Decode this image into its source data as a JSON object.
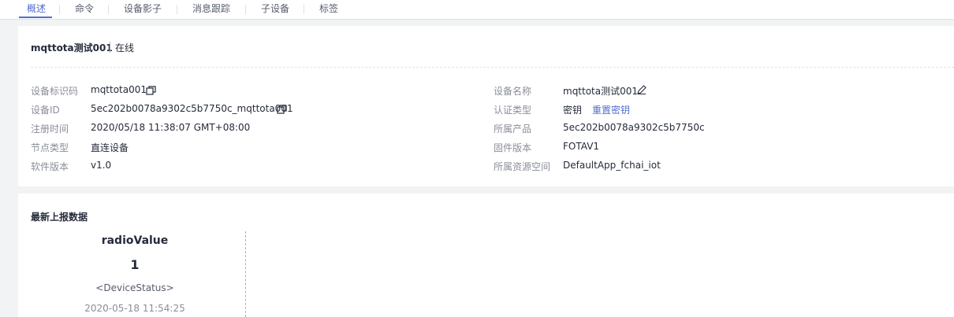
{
  "tabs": [
    "概述",
    "命令",
    "设备影子",
    "消息跟踪",
    "子设备",
    "标签"
  ],
  "device": {
    "name": "mqttota测试001",
    "status": "在线"
  },
  "details": {
    "left": [
      {
        "label": "设备标识码",
        "value": "mqttota001"
      },
      {
        "label": "设备ID",
        "value": "5ec202b0078a9302c5b7750c_mqttota001"
      },
      {
        "label": "注册时间",
        "value": "2020/05/18 11:38:07 GMT+08:00"
      },
      {
        "label": "节点类型",
        "value": "直连设备"
      },
      {
        "label": "软件版本",
        "value": "v1.0"
      }
    ],
    "right": [
      {
        "label": "设备名称",
        "value": "mqttota测试001"
      },
      {
        "label": "认证类型",
        "value": "密钥",
        "action": "重置密钥"
      },
      {
        "label": "所属产品",
        "value": "5ec202b0078a9302c5b7750c"
      },
      {
        "label": "固件版本",
        "value": "FOTAV1"
      },
      {
        "label": "所属资源空间",
        "value": "DefaultApp_fchai_iot"
      }
    ]
  },
  "latest_data": {
    "title": "最新上报数据",
    "items": [
      {
        "name": "radioValue",
        "value": "1",
        "service": "<DeviceStatus>",
        "time": "2020-05-18 11:54:25"
      }
    ]
  },
  "icons": {
    "copy": "copy-icon",
    "edit": "edit-pencil-icon"
  },
  "colors": {
    "accent": "#526ecc",
    "label": "#8a8e99",
    "text": "#252b3a",
    "background": "#f2f3f5"
  }
}
